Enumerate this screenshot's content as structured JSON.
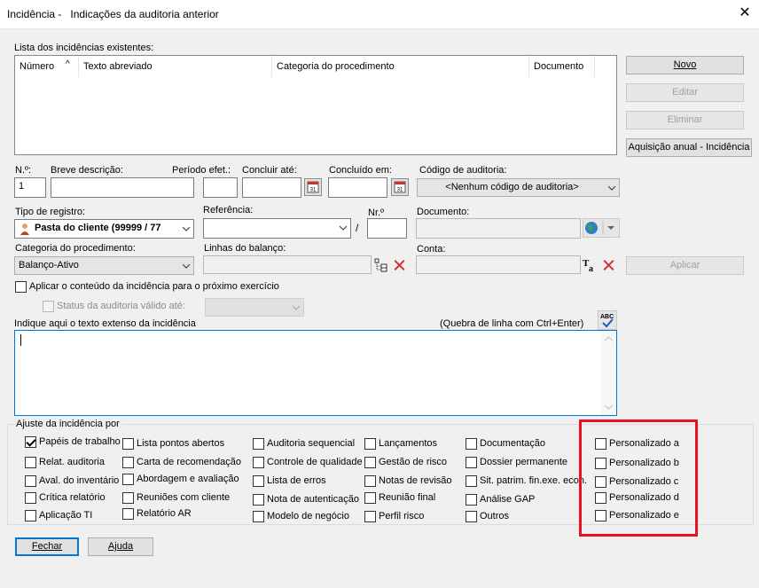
{
  "window": {
    "title": "Incidência -   Indicações da auditoria anterior",
    "close": "✕"
  },
  "list": {
    "label": "Lista dos incidências existentes:",
    "columns": [
      "Número",
      "Texto abreviado",
      "Categoria do procedimento",
      "Documento"
    ],
    "sort_arrow": "^"
  },
  "side_buttons": {
    "novo": "Novo",
    "editar": "Editar",
    "eliminar": "Eliminar",
    "aquisicao": "Aquisição anual - Incidência"
  },
  "form": {
    "numero_label": "N.º:",
    "numero_value": "1",
    "breve_label": "Breve descrição:",
    "periodo_label": "Período efet.:",
    "concluir_label": "Concluir até:",
    "concluido_label": "Concluído em:",
    "codigo_label": "Código de auditoria:",
    "codigo_value": "<Nenhum código de auditoria>",
    "tipo_label": "Tipo de registro:",
    "tipo_value": "Pasta do cliente (99999 / 77",
    "referencia_label": "Referência:",
    "nro_label": "Nr.º",
    "slash": "/",
    "documento_label": "Documento:",
    "categoria_label": "Categoria do procedimento:",
    "categoria_value": "Balanço-Ativo",
    "linhas_label": "Linhas do balanço:",
    "conta_label": "Conta:",
    "aplicar": "Aplicar",
    "aplicar_conteudo": "Aplicar o conteúdo da incidência para o próximo exercício",
    "status_label": "Status da auditoria válido até:",
    "texto_label": "Indique aqui o texto extenso da incidência",
    "quebra_hint": "(Quebra de linha com Ctrl+Enter)"
  },
  "ajuste": {
    "label": "Ajuste da incidência por",
    "col1": [
      {
        "label": "Papéis de trabalho",
        "checked": true
      },
      {
        "label": "Relat. auditoria",
        "checked": false
      },
      {
        "label": "Aval. do inventário",
        "checked": false
      },
      {
        "label": "Crítica relatório",
        "checked": false
      },
      {
        "label": "Aplicação TI",
        "checked": false
      }
    ],
    "col2": [
      {
        "label": "Lista pontos abertos",
        "checked": false
      },
      {
        "label": "Carta de recomendação",
        "checked": false
      },
      {
        "label": "Abordagem e avaliação",
        "checked": false
      },
      {
        "label": "Reuniões com cliente",
        "checked": false
      },
      {
        "label": "Relatório AR",
        "checked": false
      }
    ],
    "col3": [
      {
        "label": "Auditoria sequencial",
        "checked": false
      },
      {
        "label": "Controle de qualidade",
        "checked": false
      },
      {
        "label": "Lista de erros",
        "checked": false
      },
      {
        "label": "Nota de autenticação",
        "checked": false
      },
      {
        "label": "Modelo de negócio",
        "checked": false
      }
    ],
    "col4": [
      {
        "label": "Lançamentos",
        "checked": false
      },
      {
        "label": "Gestão de risco",
        "checked": false
      },
      {
        "label": "Notas de revisão",
        "checked": false
      },
      {
        "label": "Reunião final",
        "checked": false
      },
      {
        "label": "Perfil risco",
        "checked": false
      }
    ],
    "col5": [
      {
        "label": "Documentação",
        "checked": false
      },
      {
        "label": "Dossier permanente",
        "checked": false
      },
      {
        "label": "Sit. patrim. fin.exe. econ.",
        "checked": false
      },
      {
        "label": "Análise GAP",
        "checked": false
      },
      {
        "label": "Outros",
        "checked": false
      }
    ],
    "col6": [
      {
        "label": "Personalizado a",
        "checked": false
      },
      {
        "label": "Personalizado b",
        "checked": false
      },
      {
        "label": "Personalizado c",
        "checked": false
      },
      {
        "label": "Personalizado d",
        "checked": false
      },
      {
        "label": "Personalizado e",
        "checked": false
      }
    ]
  },
  "footer": {
    "fechar": "Fechar",
    "ajuda": "Ajuda"
  },
  "colors": {
    "highlight": "#e81123",
    "accent": "#0078d7"
  }
}
